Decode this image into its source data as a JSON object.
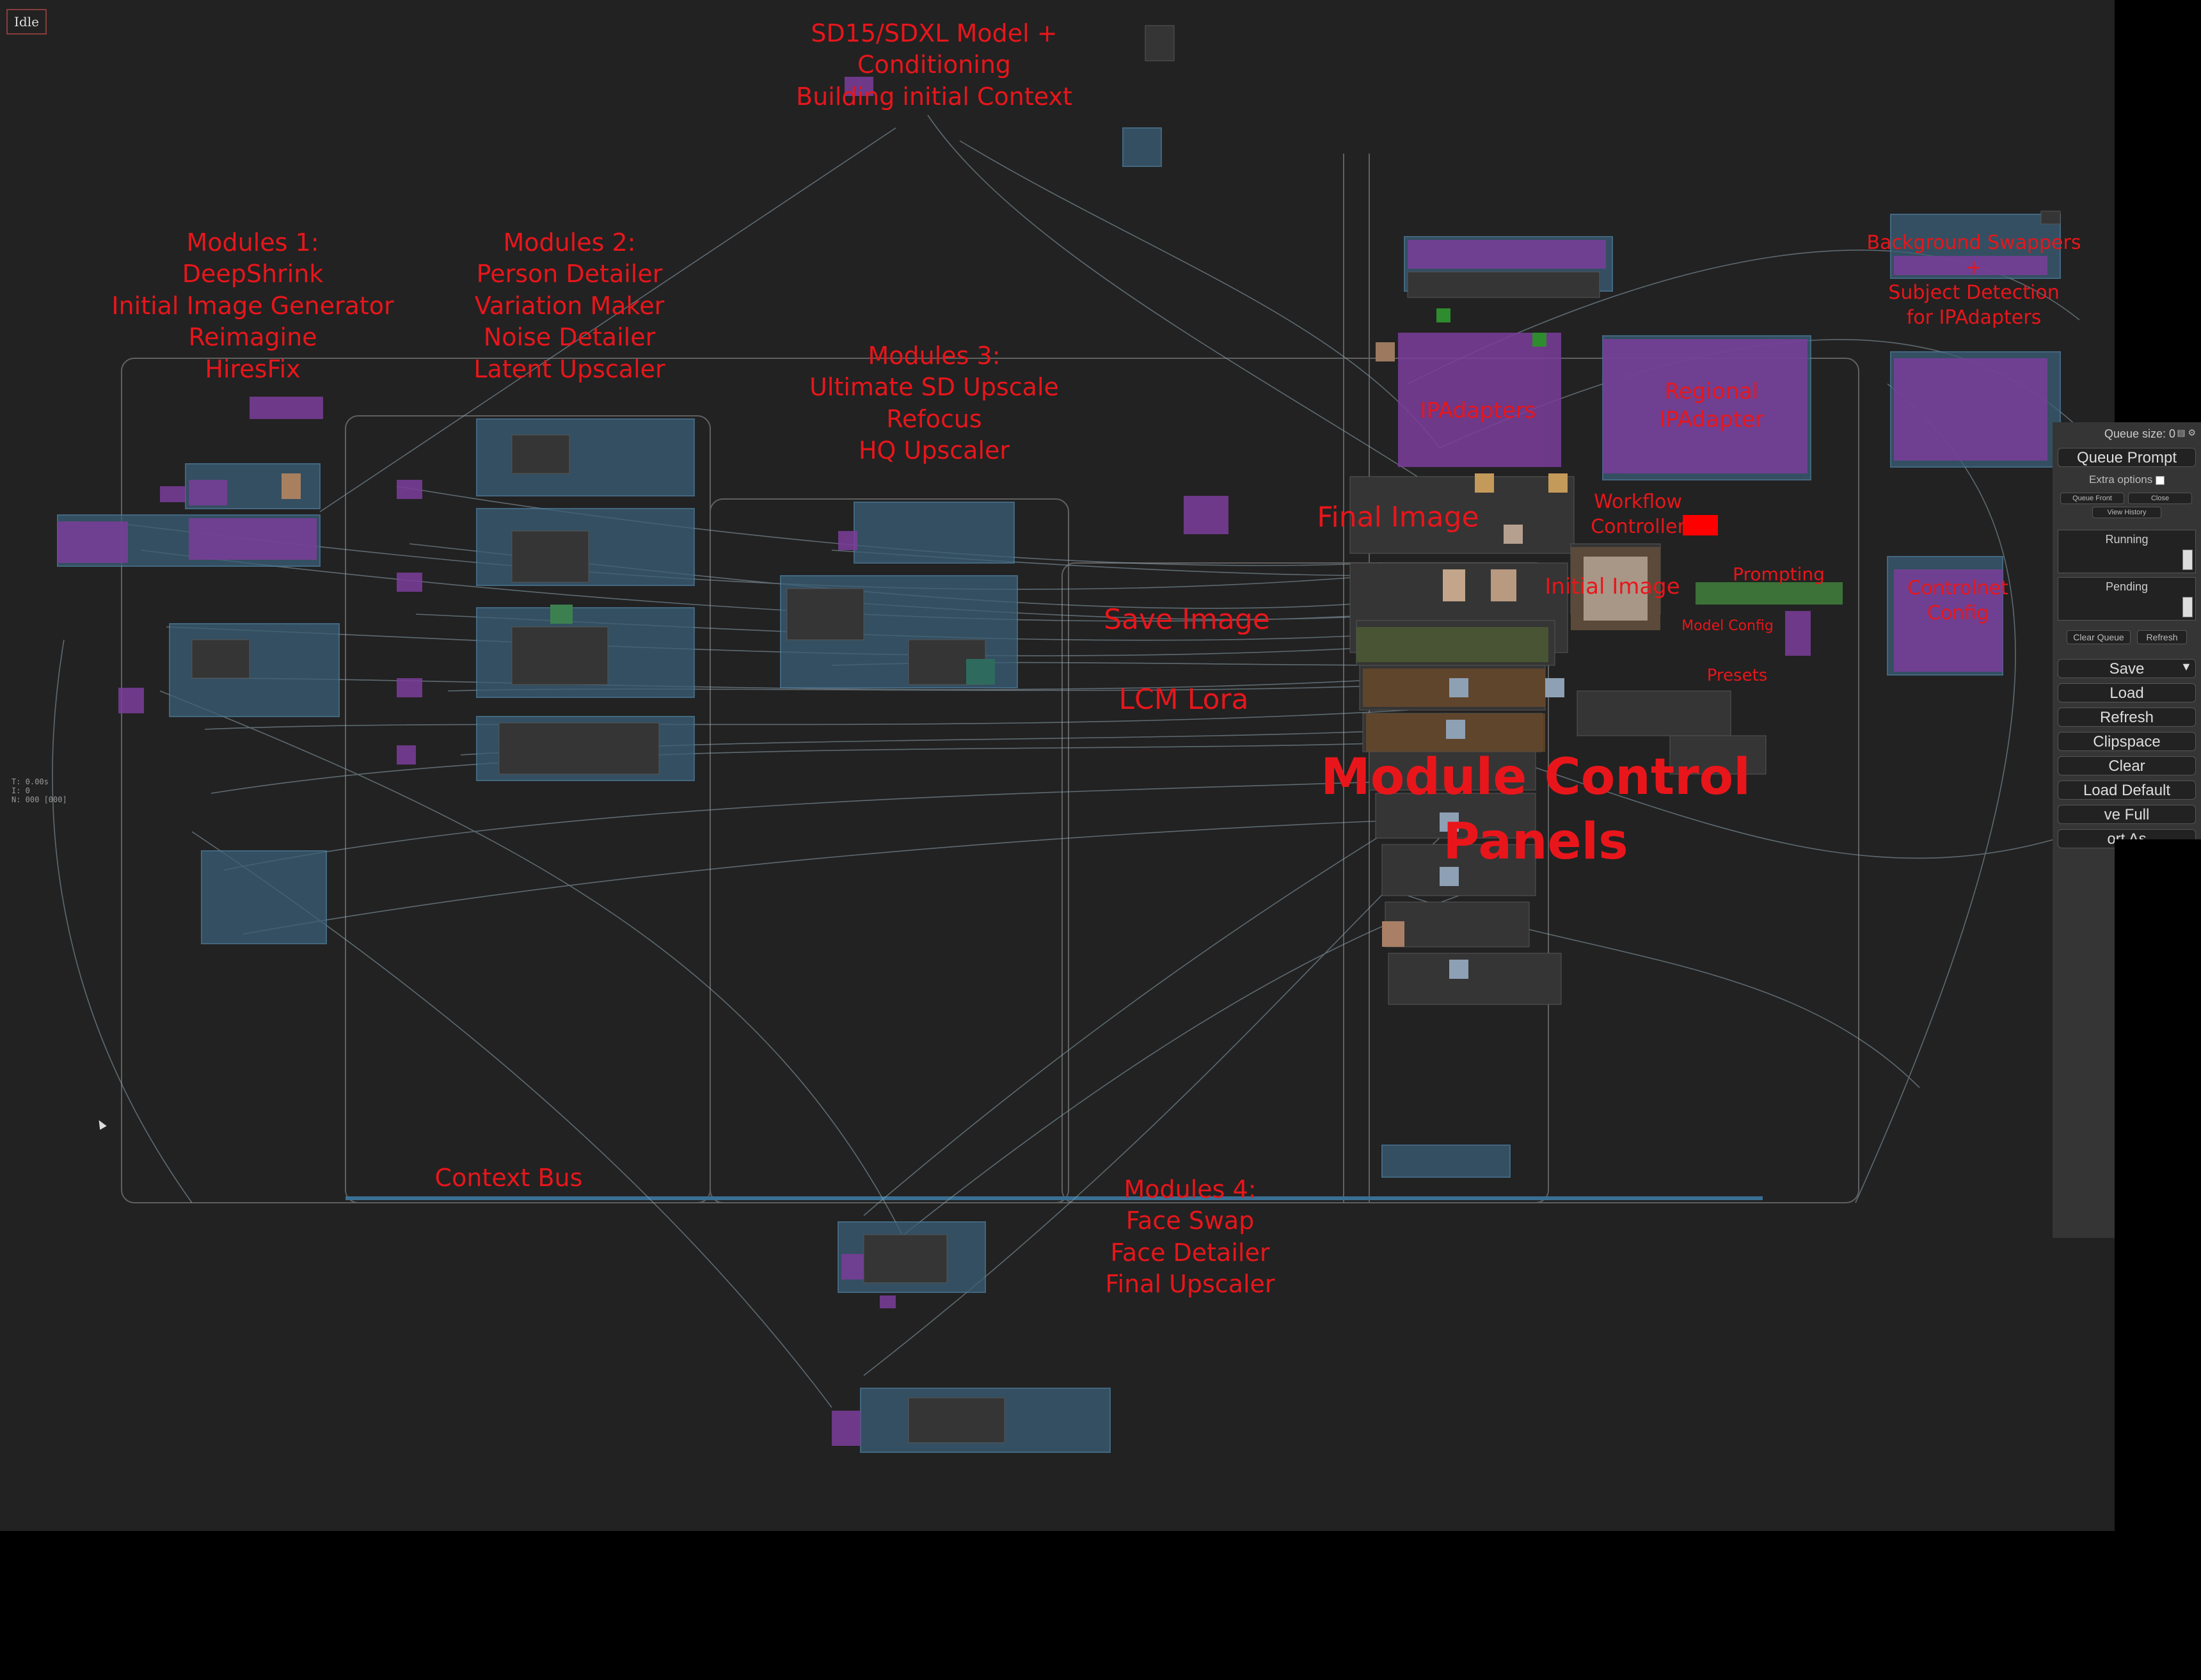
{
  "status": "Idle",
  "stats": [
    "T: 0.00s",
    "I: 0",
    "N: 000 [000]"
  ],
  "group_labels": {
    "model": "SD15/SDXL Model + Conditioning\nBuilding initial Context",
    "modules1": "Modules 1:\nDeepShrink\nInitial Image Generator\nReimagine\nHiresFix",
    "modules2": "Modules 2:\nPerson Detailer\nVariation Maker\nNoise Detailer\nLatent Upscaler",
    "modules3": "Modules 3:\nUltimate SD Upscale\nRefocus\nHQ Upscaler",
    "modules4": "Modules 4:\nFace Swap\nFace Detailer\nFinal Upscaler",
    "context_bus": "Context Bus",
    "save_image": "Save Image",
    "lcm_lora": "LCM Lora",
    "final_image": "Final Image",
    "ipadapters": "IPAdapters",
    "regional": "Regional\nIPAdapter",
    "background": "Background Swappers\n+\nSubject Detection\nfor IPAdapters",
    "workflow": "Workflow\nController",
    "initial_image": "Initial Image",
    "prompting": "Prompting",
    "model_config": "Model Config",
    "presets": "Presets",
    "controlnet": "Controlnet\nConfig",
    "control_panels": "Module Control Panels"
  },
  "menu": {
    "queue_size": "Queue size: 0",
    "queue_prompt": "Queue Prompt",
    "extra_options": "Extra options",
    "queue_front": "Queue Front",
    "close": "Close",
    "view_history": "View History",
    "running": "Running",
    "pending": "Pending",
    "clear_queue": "Clear Queue",
    "refresh_small": "Refresh",
    "save": "Save",
    "load": "Load",
    "refresh": "Refresh",
    "clipspace": "Clipspace",
    "clear": "Clear",
    "load_default": "Load Default",
    "save_full": "ve Full",
    "export": "ort As"
  },
  "colors": {
    "canvas": "#222222",
    "label": "#e8161b",
    "node": "#353535",
    "group_blue": "#3f6e8a",
    "group_purple": "#7a3d9a"
  }
}
